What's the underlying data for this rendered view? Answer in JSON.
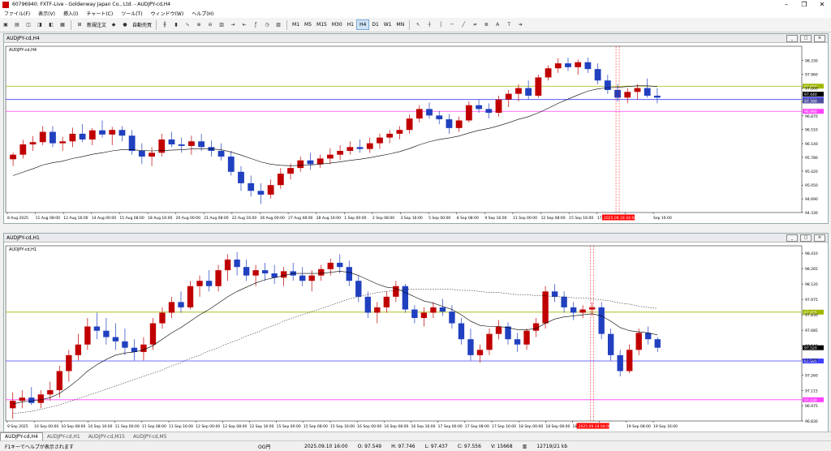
{
  "window": {
    "title": "60796940: FXTF-Live - Goldenway Japan Co., Ltd. - AUDJPY-cd,H4"
  },
  "menu": [
    "ファイル(F)",
    "表示(V)",
    "挿入(I)",
    "チャート(C)",
    "ツール(T)",
    "ウィンドウ(W)",
    "ヘルプ(H)"
  ],
  "toolbar": {
    "new_order": "新規注文",
    "auto_trade": "自動売買",
    "timeframes": [
      "M1",
      "M5",
      "M15",
      "M30",
      "H1",
      "H4",
      "D1",
      "W1",
      "MN"
    ],
    "active_timeframe": "H4"
  },
  "charts": [
    {
      "window_title": "AUDJPY-cd,H4",
      "symbol_label": "AUDJPY-cd,H4",
      "ohlc": [
        [
          95.73,
          95.9,
          95.55,
          95.85
        ],
        [
          95.85,
          96.24,
          95.75,
          96.12
        ],
        [
          96.12,
          96.34,
          95.95,
          96.18
        ],
        [
          96.18,
          96.6,
          96.1,
          96.45
        ],
        [
          96.45,
          96.6,
          96.05,
          96.15
        ],
        [
          96.15,
          96.32,
          95.95,
          96.2
        ],
        [
          96.2,
          96.56,
          96.05,
          96.4
        ],
        [
          96.4,
          96.65,
          96.18,
          96.25
        ],
        [
          96.25,
          96.55,
          96.1,
          96.49
        ],
        [
          96.49,
          96.75,
          96.3,
          96.38
        ],
        [
          96.38,
          96.58,
          96.1,
          96.5
        ],
        [
          96.5,
          96.6,
          96.2,
          96.35
        ],
        [
          96.35,
          96.5,
          95.85,
          95.95
        ],
        [
          95.95,
          96.15,
          95.6,
          95.8
        ],
        [
          95.8,
          96.05,
          95.55,
          95.9
        ],
        [
          95.9,
          96.4,
          95.8,
          96.25
        ],
        [
          96.25,
          96.45,
          96.05,
          96.12
        ],
        [
          96.12,
          96.3,
          95.9,
          96.08
        ],
        [
          96.08,
          96.35,
          95.85,
          96.2
        ],
        [
          96.2,
          96.4,
          95.95,
          96.05
        ],
        [
          96.05,
          96.22,
          95.8,
          95.95
        ],
        [
          95.95,
          96.15,
          95.7,
          95.8
        ],
        [
          95.8,
          95.95,
          95.3,
          95.4
        ],
        [
          95.4,
          95.55,
          94.9,
          95.1
        ],
        [
          95.1,
          95.3,
          94.75,
          94.9
        ],
        [
          94.9,
          95.1,
          94.55,
          94.8
        ],
        [
          94.8,
          95.2,
          94.7,
          95.05
        ],
        [
          95.05,
          95.5,
          94.95,
          95.35
        ],
        [
          95.35,
          95.62,
          95.2,
          95.5
        ],
        [
          95.5,
          95.8,
          95.4,
          95.7
        ],
        [
          95.7,
          95.9,
          95.45,
          95.6
        ],
        [
          95.6,
          95.85,
          95.5,
          95.75
        ],
        [
          95.75,
          96.02,
          95.6,
          95.85
        ],
        [
          95.85,
          96.1,
          95.7,
          95.95
        ],
        [
          95.95,
          96.2,
          95.85,
          96.05
        ],
        [
          96.05,
          96.25,
          95.9,
          96.0
        ],
        [
          96.0,
          96.3,
          95.9,
          96.15
        ],
        [
          96.15,
          96.4,
          96.0,
          96.3
        ],
        [
          96.3,
          96.5,
          96.15,
          96.4
        ],
        [
          96.4,
          96.6,
          96.25,
          96.5
        ],
        [
          96.5,
          96.9,
          96.4,
          96.8
        ],
        [
          96.8,
          97.15,
          96.7,
          97.05
        ],
        [
          97.05,
          97.22,
          96.8,
          96.88
        ],
        [
          96.88,
          97.0,
          96.65,
          96.78
        ],
        [
          96.78,
          96.92,
          96.4,
          96.55
        ],
        [
          96.55,
          96.85,
          96.45,
          96.75
        ],
        [
          96.75,
          97.25,
          96.7,
          97.15
        ],
        [
          97.15,
          97.3,
          96.95,
          97.05
        ],
        [
          97.05,
          97.2,
          96.8,
          96.95
        ],
        [
          96.95,
          97.4,
          96.85,
          97.3
        ],
        [
          97.3,
          97.55,
          97.1,
          97.45
        ],
        [
          97.45,
          97.7,
          97.25,
          97.6
        ],
        [
          97.6,
          97.8,
          97.3,
          97.4
        ],
        [
          97.4,
          97.95,
          97.35,
          97.88
        ],
        [
          97.88,
          98.2,
          97.8,
          98.12
        ],
        [
          98.12,
          98.38,
          98.0,
          98.25
        ],
        [
          98.25,
          98.4,
          98.05,
          98.15
        ],
        [
          98.15,
          98.35,
          97.95,
          98.28
        ],
        [
          98.28,
          98.4,
          98.0,
          98.1
        ],
        [
          98.1,
          98.25,
          97.7,
          97.8
        ],
        [
          97.8,
          97.95,
          97.45,
          97.55
        ],
        [
          97.55,
          97.7,
          97.25,
          97.35
        ],
        [
          97.35,
          97.6,
          97.2,
          97.5
        ],
        [
          97.5,
          97.7,
          97.3,
          97.6
        ],
        [
          97.6,
          97.85,
          97.35,
          97.4
        ],
        [
          97.4,
          97.6,
          97.2,
          97.35
        ]
      ],
      "ma": [
        95.3,
        95.39,
        95.48,
        95.58,
        95.64,
        95.68,
        95.75,
        95.8,
        95.86,
        95.9,
        95.95,
        95.98,
        95.98,
        95.96,
        95.95,
        95.96,
        95.97,
        95.98,
        96.0,
        96.0,
        96.0,
        95.98,
        95.92,
        95.84,
        95.75,
        95.66,
        95.6,
        95.57,
        95.56,
        95.57,
        95.58,
        95.6,
        95.63,
        95.66,
        95.7,
        95.73,
        95.77,
        95.82,
        95.87,
        95.93,
        96.01,
        96.11,
        96.19,
        96.25,
        96.29,
        96.34,
        96.42,
        96.49,
        96.54,
        96.61,
        96.69,
        96.78,
        96.85,
        96.95,
        97.07,
        97.2,
        97.31,
        97.42,
        97.52,
        97.58,
        97.61,
        97.62,
        97.64,
        97.66,
        97.66,
        97.64
      ],
      "y_range": [
        94.33,
        98.7
      ],
      "ticks": [
        98.33,
        97.96,
        97.6,
        97.24,
        96.87,
        96.51,
        96.14,
        95.78,
        95.42,
        95.05,
        94.69,
        94.33
      ],
      "tick_labels": [
        "98.330",
        "97.960",
        "97.600",
        "97.240",
        "96.870",
        "96.510",
        "96.140",
        "95.780",
        "95.420",
        "95.050",
        "94.690",
        "94.330"
      ],
      "hlines": [
        {
          "value": 97.65,
          "color": "#a0b800",
          "label": "97.650"
        },
        {
          "value": 97.3,
          "color": "#4040ff",
          "label": "97.300"
        },
        {
          "value": 96.99,
          "color": "#ff40ff",
          "label": "96.990"
        }
      ],
      "price_tag": {
        "value": 97.44,
        "label": "97.440"
      },
      "price_tag2": {
        "value": 97.39,
        "label": "97.390"
      },
      "x_labels": [
        "8 Aug 2025",
        "11 Aug 08:00",
        "12 Aug 16:00",
        "14 Aug 00:00",
        "15 Aug 08:00",
        "18 Aug 16:00",
        "20 Aug 00:00",
        "21 Aug 08:00",
        "22 Aug 16:00",
        "26 Aug 00:00",
        "27 Aug 08:00",
        "28 Aug 16:00",
        "1 Sep 00:00",
        "2 Sep 08:00",
        "3 Sep 16:00",
        "5 Sep 00:00",
        "8 Sep 08:00",
        "9 Sep 16:00",
        "11 Sep 00:00",
        "12 Sep 08:00",
        "15 Sep 16:00",
        "17 Sep 00:00",
        "",
        "Sep 16:00"
      ],
      "cursor_label": "2025.09.19 04:00",
      "cursor_index": 61
    },
    {
      "window_title": "AUDJPY-cd,H1",
      "symbol_label": "AUDJPY-cd,H1",
      "ohlc": [
        [
          96.95,
          97.1,
          96.85,
          97.02
        ],
        [
          97.02,
          97.12,
          96.95,
          97.05
        ],
        [
          97.05,
          97.15,
          96.98,
          97.0
        ],
        [
          97.0,
          97.12,
          96.95,
          97.08
        ],
        [
          97.08,
          97.2,
          97.02,
          97.12
        ],
        [
          97.12,
          97.35,
          97.05,
          97.3
        ],
        [
          97.3,
          97.5,
          97.2,
          97.45
        ],
        [
          97.45,
          97.65,
          97.4,
          97.55
        ],
        [
          97.55,
          97.8,
          97.5,
          97.72
        ],
        [
          97.72,
          97.85,
          97.6,
          97.68
        ],
        [
          97.68,
          97.8,
          97.55,
          97.62
        ],
        [
          97.62,
          97.75,
          97.5,
          97.58
        ],
        [
          97.58,
          97.7,
          97.45,
          97.52
        ],
        [
          97.52,
          97.6,
          97.4,
          97.48
        ],
        [
          97.48,
          97.62,
          97.4,
          97.55
        ],
        [
          97.55,
          97.8,
          97.5,
          97.75
        ],
        [
          97.75,
          97.9,
          97.7,
          97.85
        ],
        [
          97.85,
          98.0,
          97.8,
          97.95
        ],
        [
          97.95,
          98.05,
          97.85,
          97.9
        ],
        [
          97.9,
          98.15,
          97.88,
          98.1
        ],
        [
          98.1,
          98.2,
          98.0,
          98.15
        ],
        [
          98.15,
          98.25,
          98.05,
          98.1
        ],
        [
          98.1,
          98.3,
          98.05,
          98.25
        ],
        [
          98.25,
          98.4,
          98.15,
          98.35
        ],
        [
          98.35,
          98.42,
          98.2,
          98.28
        ],
        [
          98.28,
          98.35,
          98.15,
          98.2
        ],
        [
          98.2,
          98.3,
          98.1,
          98.25
        ],
        [
          98.25,
          98.32,
          98.15,
          98.22
        ],
        [
          98.22,
          98.3,
          98.12,
          98.18
        ],
        [
          98.18,
          98.28,
          98.1,
          98.24
        ],
        [
          98.24,
          98.32,
          98.15,
          98.2
        ],
        [
          98.2,
          98.28,
          98.1,
          98.15
        ],
        [
          98.15,
          98.25,
          98.05,
          98.2
        ],
        [
          98.2,
          98.3,
          98.15,
          98.26
        ],
        [
          98.26,
          98.36,
          98.2,
          98.32
        ],
        [
          98.32,
          98.4,
          98.22,
          98.28
        ],
        [
          98.28,
          98.34,
          98.1,
          98.15
        ],
        [
          98.15,
          98.2,
          97.95,
          98.0
        ],
        [
          98.0,
          98.05,
          97.8,
          97.85
        ],
        [
          97.85,
          97.95,
          97.75,
          97.9
        ],
        [
          97.9,
          98.05,
          97.85,
          98.0
        ],
        [
          98.0,
          98.15,
          97.95,
          98.1
        ],
        [
          98.1,
          98.12,
          97.85,
          97.88
        ],
        [
          97.88,
          97.92,
          97.75,
          97.8
        ],
        [
          97.8,
          97.9,
          97.72,
          97.85
        ],
        [
          97.85,
          97.95,
          97.8,
          97.9
        ],
        [
          97.9,
          97.98,
          97.82,
          97.86
        ],
        [
          97.86,
          97.92,
          97.7,
          97.75
        ],
        [
          97.75,
          97.8,
          97.55,
          97.6
        ],
        [
          97.6,
          97.7,
          97.4,
          97.45
        ],
        [
          97.45,
          97.55,
          97.38,
          97.5
        ],
        [
          97.5,
          97.7,
          97.45,
          97.65
        ],
        [
          97.65,
          97.78,
          97.6,
          97.72
        ],
        [
          97.72,
          97.76,
          97.55,
          97.6
        ],
        [
          97.6,
          97.66,
          97.48,
          97.55
        ],
        [
          97.55,
          97.7,
          97.5,
          97.68
        ],
        [
          97.68,
          97.8,
          97.62,
          97.75
        ],
        [
          97.75,
          98.1,
          97.7,
          98.05
        ],
        [
          98.05,
          98.12,
          97.95,
          98.0
        ],
        [
          98.0,
          98.05,
          97.85,
          97.9
        ],
        [
          97.9,
          97.95,
          97.78,
          97.85
        ],
        [
          97.85,
          97.92,
          97.8,
          97.88
        ],
        [
          97.88,
          97.95,
          97.82,
          97.9
        ],
        [
          97.9,
          97.95,
          97.6,
          97.65
        ],
        [
          97.65,
          97.7,
          97.4,
          97.45
        ],
        [
          97.45,
          97.5,
          97.25,
          97.3
        ],
        [
          97.3,
          97.55,
          97.28,
          97.5
        ],
        [
          97.5,
          97.7,
          97.45,
          97.66
        ],
        [
          97.66,
          97.72,
          97.55,
          97.6
        ],
        [
          97.6,
          97.62,
          97.48,
          97.52
        ]
      ],
      "ma": [
        96.99,
        97.01,
        97.02,
        97.03,
        97.05,
        97.09,
        97.15,
        97.22,
        97.3,
        97.36,
        97.41,
        97.45,
        97.47,
        97.48,
        97.5,
        97.54,
        97.6,
        97.66,
        97.71,
        97.77,
        97.83,
        97.88,
        97.94,
        98.0,
        98.05,
        98.09,
        98.13,
        98.16,
        98.18,
        98.2,
        98.22,
        98.22,
        98.22,
        98.22,
        98.23,
        98.24,
        98.23,
        98.2,
        98.16,
        98.12,
        98.09,
        98.08,
        98.04,
        98.0,
        97.96,
        97.94,
        97.91,
        97.88,
        97.83,
        97.77,
        97.73,
        97.72,
        97.72,
        97.71,
        97.69,
        97.69,
        97.7,
        97.75,
        97.79,
        97.81,
        97.82,
        97.83,
        97.84,
        97.82,
        97.77,
        97.71,
        97.68,
        97.67,
        97.66,
        97.64
      ],
      "ma_slow": [
        96.9,
        96.91,
        96.92,
        96.94,
        96.96,
        96.98,
        97.01,
        97.04,
        97.07,
        97.1,
        97.13,
        97.16,
        97.19,
        97.22,
        97.25,
        97.28,
        97.31,
        97.35,
        97.38,
        97.42,
        97.45,
        97.49,
        97.52,
        97.56,
        97.59,
        97.63,
        97.66,
        97.7,
        97.73,
        97.77,
        97.8,
        97.83,
        97.86,
        97.89,
        97.92,
        97.95,
        97.98,
        98.0,
        98.02,
        98.04,
        98.05,
        98.06,
        98.07,
        98.07,
        98.07,
        98.07,
        98.07,
        98.07,
        98.06,
        98.06,
        98.05,
        98.04,
        98.04,
        98.03,
        98.02,
        98.02,
        98.01,
        98.01,
        98.0,
        98.0,
        97.99,
        97.99,
        97.98,
        97.97,
        97.96,
        97.94,
        97.93,
        97.91,
        97.9,
        97.89
      ],
      "y_range": [
        96.83,
        98.48
      ],
      "ticks": [
        98.41,
        98.265,
        98.12,
        97.975,
        97.83,
        97.685,
        97.54,
        97.405,
        97.26,
        97.115,
        96.975,
        96.83
      ],
      "tick_labels": [
        "98.410",
        "98.265",
        "98.120",
        "97.975",
        "97.830",
        "97.685",
        "97.540",
        "97.405",
        "97.260",
        "97.115",
        "96.975",
        "96.830"
      ],
      "hlines": [
        {
          "value": 97.855,
          "color": "#a0b800",
          "label": "97.855"
        },
        {
          "value": 97.395,
          "color": "#4040ff",
          "label": "97.395"
        },
        {
          "value": 97.03,
          "color": "#ff40ff",
          "label": "97.030"
        }
      ],
      "price_tag": {
        "value": 97.52,
        "label": "97.520"
      },
      "x_labels": [
        "9 Sep 2025",
        "10 Sep 00:00",
        "10 Sep 08:00",
        "10 Sep 16:00",
        "11 Sep 00:00",
        "11 Sep 08:00",
        "11 Sep 16:00",
        "12 Sep 00:00",
        "12 Sep 08:00",
        "12 Sep 16:00",
        "15 Sep 00:00",
        "15 Sep 08:00",
        "15 Sep 16:00",
        "16 Sep 00:00",
        "16 Sep 08:00",
        "16 Sep 16:00",
        "17 Sep 00:00",
        "17 Sep 08:00",
        "17 Sep 16:00",
        "18 Sep 00:00",
        "18 Sep 08:00",
        "18 Sep 16:00",
        "",
        "19 Sep 08:00",
        "19 Sep 16:00"
      ],
      "cursor_label": "2025.09.19 04:00",
      "cursor_index": 62
    }
  ],
  "tabs": [
    "AUDJPY-cd,H4",
    "AUDJPY-cd,H1",
    "AUDJPY-cd,M15",
    "AUDJPY-cd,M5"
  ],
  "active_tab": 0,
  "status": {
    "help": "F1キーでヘルプが表示されます",
    "profile": "OG円",
    "datetime": "2025.09.10 16:00",
    "open": "O: 97.549",
    "high": "H: 97.746",
    "low": "L: 97.437",
    "close": "C: 97.556",
    "volume": "V: 15668",
    "traffic": "12719/21 kb"
  },
  "colors": {
    "bull": "#c00000",
    "bear": "#2040c0",
    "ma": "#000000",
    "cursor": "#ff0000"
  }
}
